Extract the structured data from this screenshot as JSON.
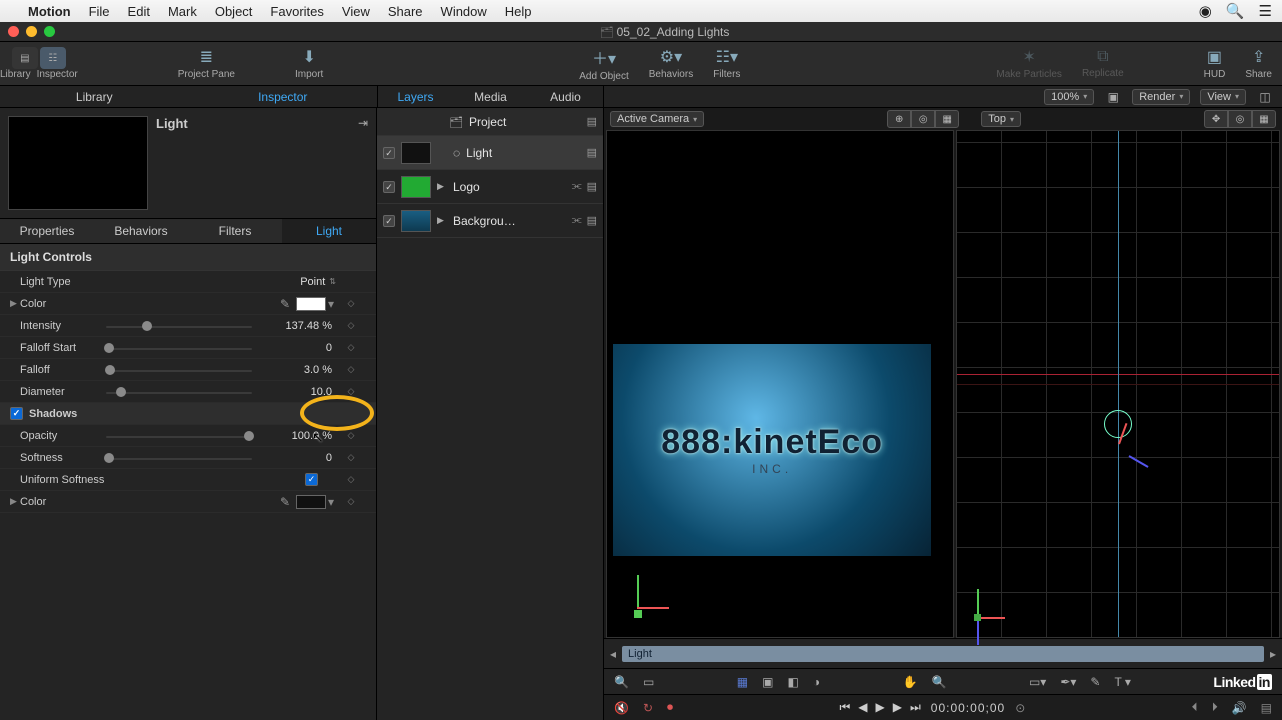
{
  "menubar": {
    "app": "Motion",
    "items": [
      "File",
      "Edit",
      "Mark",
      "Object",
      "Favorites",
      "View",
      "Share",
      "Window",
      "Help"
    ]
  },
  "window": {
    "title": "05_02_Adding Lights"
  },
  "toolbar": {
    "library_label": "Library",
    "inspector_label": "Inspector",
    "project_pane": "Project Pane",
    "import": "Import",
    "add_object": "Add Object",
    "behaviors": "Behaviors",
    "filters": "Filters",
    "make_particles": "Make Particles",
    "replicate": "Replicate",
    "hud": "HUD",
    "share": "Share"
  },
  "tabs": {
    "library": "Library",
    "inspector": "Inspector",
    "layers": "Layers",
    "media": "Media",
    "audio": "Audio",
    "zoom": "100%",
    "render": "Render",
    "view": "View"
  },
  "inspector": {
    "name": "Light",
    "tabs": {
      "properties": "Properties",
      "behaviors": "Behaviors",
      "filters": "Filters",
      "light": "Light"
    },
    "section": "Light Controls",
    "params": {
      "light_type_label": "Light Type",
      "light_type_value": "Point",
      "color_label": "Color",
      "color_value": "#ffffff",
      "intensity_label": "Intensity",
      "intensity_value": "137.48 %",
      "falloff_start_label": "Falloff Start",
      "falloff_start_value": "0",
      "falloff_label": "Falloff",
      "falloff_value": "3.0 %",
      "diameter_label": "Diameter",
      "diameter_value": "10.0",
      "shadows_label": "Shadows",
      "shadows_on": true,
      "opacity_label": "Opacity",
      "opacity_value": "100.0 %",
      "softness_label": "Softness",
      "softness_value": "0",
      "uniform_softness_label": "Uniform Softness",
      "uniform_softness_on": true,
      "shadow_color_label": "Color",
      "shadow_color_value": "#000000"
    }
  },
  "layers": {
    "project": "Project",
    "items": [
      {
        "name": "Light",
        "kind": "light"
      },
      {
        "name": "Logo",
        "kind": "group"
      },
      {
        "name": "Backgrou…",
        "kind": "group"
      }
    ]
  },
  "viewport": {
    "cam_label": "Active Camera",
    "top_label": "Top",
    "logo_text": "kinetEco",
    "logo_prefix": "888:",
    "logo_sub": "INC."
  },
  "timeline": {
    "track_label": "Light"
  },
  "playbar": {
    "timecode": "00:00:00;00"
  },
  "footer": {
    "brand": "Linked",
    "brand_in": "in"
  }
}
